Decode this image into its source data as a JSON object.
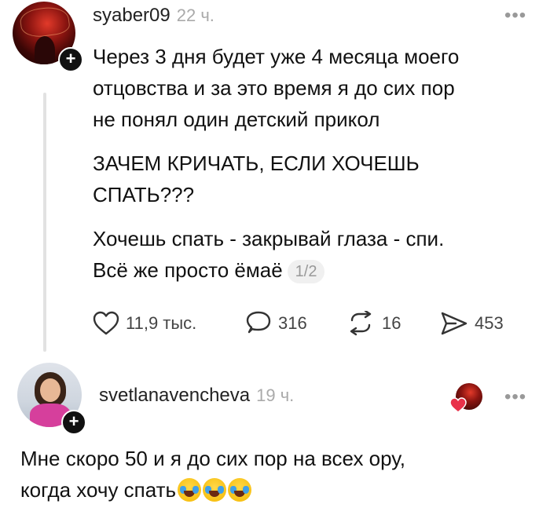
{
  "comment1": {
    "username": "syaber09",
    "time": "22 ч.",
    "paragraphs": [
      "Через 3 дня будет уже 4 месяца моего",
      "отцовства и за это время я до сих пор",
      "не понял один детский прикол"
    ],
    "paragraph2_line1": "ЗАЧЕМ КРИЧАТЬ, ЕСЛИ ХОЧЕШЬ",
    "paragraph2_line2": "СПАТЬ???",
    "paragraph3_line1": "Хочешь спать - закрывай глаза - спи.",
    "paragraph3_line2": "Всё же просто ёмаё",
    "page_indicator": "1/2",
    "actions": {
      "likes": "11,9 тыс.",
      "comments": "316",
      "reposts": "16",
      "shares": "453"
    },
    "more_icon": "ellipsis-icon"
  },
  "comment2": {
    "username": "svetlanavencheva",
    "time": "19 ч.",
    "text_line1": "Мне скоро 50 и я до сих пор на всех ору,",
    "text_line2": "когда хочу спать",
    "emoji": [
      "face-with-tears-of-joy",
      "face-with-tears-of-joy",
      "face-with-tears-of-joy"
    ],
    "author_liked_icon": "heart-icon",
    "more_icon": "ellipsis-icon"
  },
  "colors": {
    "text": "#111111",
    "muted": "#aaaaaa",
    "heart": "#e8314a",
    "thread_line": "#e2e2e2"
  }
}
